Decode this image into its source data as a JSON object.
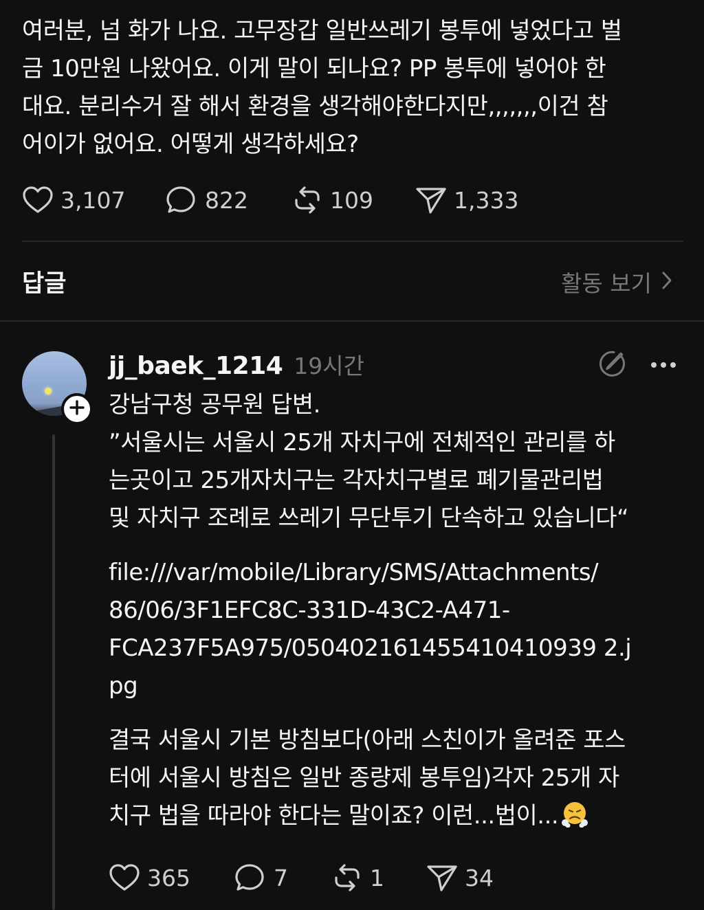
{
  "post": {
    "lines": [
      "여러분, 넘 화가 나요. 고무장갑 일반쓰레기 봉투에 넣었다고 벌",
      "금 10만원 나왔어요. 이게 말이 되나요? PP 봉투에 넣어야 한",
      "대요. 분리수거 잘 해서 환경을 생각해야한다지만,,,,,,,이건 참",
      "어이가 없어요. 어떻게 생각하세요?"
    ],
    "likes": "3,107",
    "comments": "822",
    "reposts": "109",
    "shares": "1,333"
  },
  "replies_section": {
    "title": "답글",
    "activity_label": "활동 보기"
  },
  "reply": {
    "username": "jj_baek_1214",
    "time": "19시간",
    "lines": [
      "강남구청 공무원 답변.",
      "”서울시는 서울시 25개 자치구에 전체적인 관리를 하",
      "는곳이고  25개자치구는  각자치구별로 폐기물관리법",
      "및 자치구 조례로 쓰레기 무단투기 단속하고 있습니다“"
    ],
    "link_lines": [
      "file:///var/mobile/Library/SMS/Attachments/",
      "86/06/3F1EFC8C-331D-43C2-A471-",
      "FCA237F5A975/050402161455410410939 2.j",
      "pg"
    ],
    "closing_lines": [
      "결국 서울시 기본 방침보다(아래 스친이가 올려준 포스",
      "터에 서울시 방침은 일반 종량제 봉투임)각자 25개 자",
      "치구 법을 따라야 한다는 말이죠? 이런...법이..."
    ],
    "emoji_name": "face-with-steam-from-nose",
    "likes": "365",
    "comments": "7",
    "reposts": "1",
    "shares": "34"
  },
  "icons": {
    "like": "heart-icon",
    "comment": "comment-bubble-icon",
    "repost": "repost-icon",
    "share": "send-icon",
    "chevron": "chevron-right-icon",
    "follow": "plus-icon",
    "quote": "quote-icon",
    "more": "more-icon"
  },
  "colors": {
    "background": "#101010",
    "text": "#f3f5f7",
    "muted": "#777777",
    "divider": "#262626"
  }
}
